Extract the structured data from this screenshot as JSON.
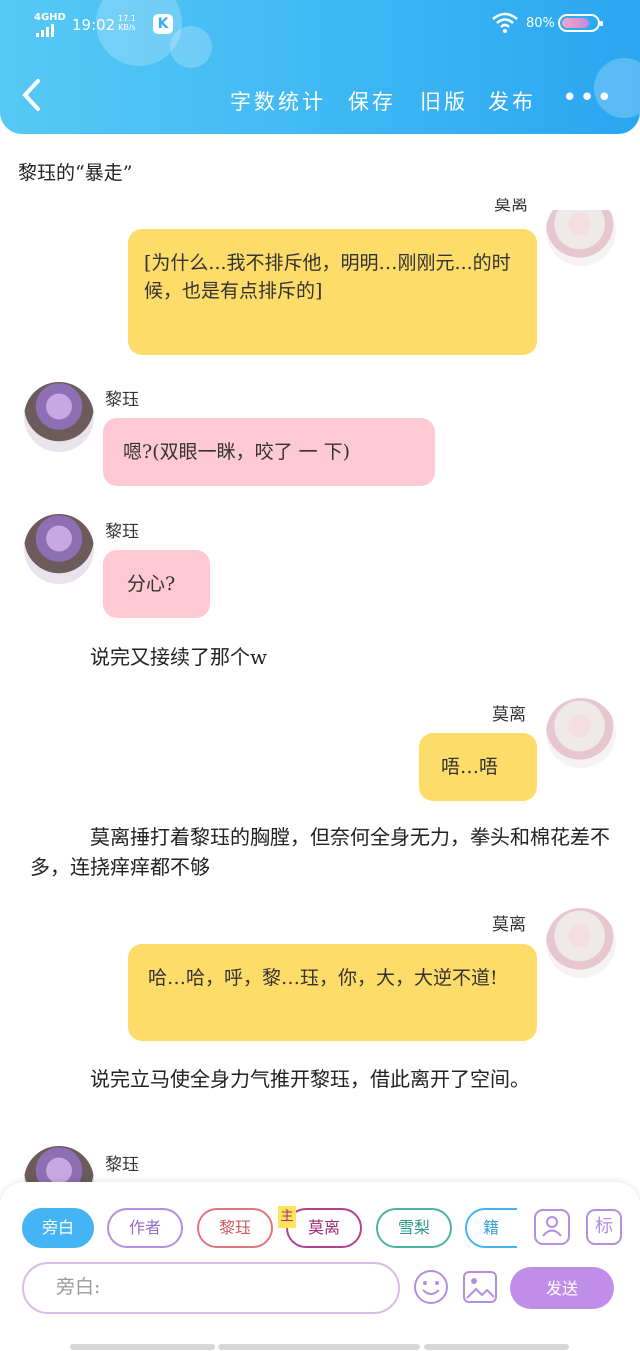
{
  "status_bar": {
    "network": "4GHD",
    "time": "19:02",
    "speed_value": "17.1",
    "speed_unit": "KB/s",
    "app_badge": "K",
    "battery": "80%",
    "battery_level": 0.8
  },
  "toolbar": {
    "word_count": "字数统计",
    "save": "保存",
    "old_version": "旧版",
    "publish": "发布",
    "more": "•••"
  },
  "chapter_title": "黎珏的“暴走”",
  "messages": [
    {
      "speaker": "莫离",
      "name_visible": "莫离",
      "text": "[为什么...我不排斥他，明明…刚刚元...的时候，也是有点排斥的]"
    },
    {
      "speaker": "黎珏",
      "name": "黎珏",
      "text": "嗯?(双眼一眯，咬了 一 下)"
    },
    {
      "speaker": "黎珏",
      "name": "黎珏",
      "text": "分心?"
    },
    {
      "narration": "说完又接续了那个w"
    },
    {
      "speaker": "莫离",
      "name": "莫离",
      "text": "唔…唔"
    },
    {
      "narration": "莫离捶打着黎珏的胸膛，但奈何全身无力，拳头和棉花差不多，连挠痒痒都不够"
    },
    {
      "speaker": "莫离",
      "name": "莫离",
      "text": "哈…哈，呼，黎…珏，你，大，大逆不道!"
    },
    {
      "narration": "说完立马使全身力气推开黎珏，借此离开了空间。"
    },
    {
      "speaker": "黎珏",
      "name": "黎珏"
    }
  ],
  "composer": {
    "roles": [
      "旁白",
      "作者",
      "黎珏",
      "莫离",
      "雪梨",
      "籍"
    ],
    "main_tag": "主",
    "active_role": "旁白",
    "contacts_icon": "contacts-icon",
    "tag_button": "标",
    "input_placeholder": "旁白:",
    "send": "发送"
  }
}
